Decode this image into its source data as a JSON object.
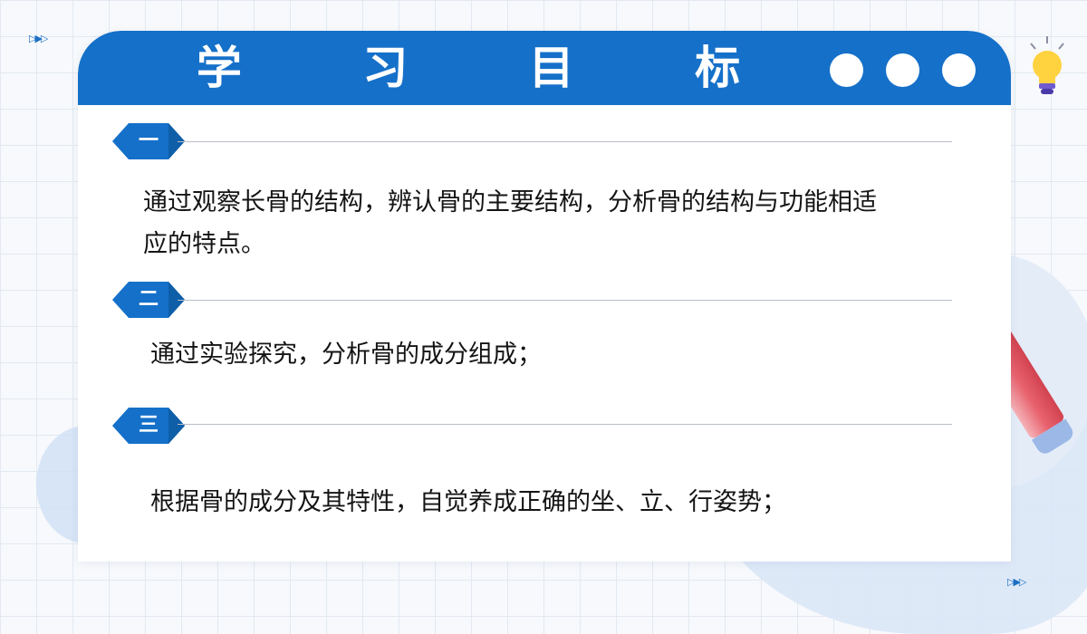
{
  "title": "学 习 目 标",
  "objectives": [
    {
      "marker": "一",
      "text_line1": "通过观察长骨的结构，辨认骨的主要结构，分析骨的结构与功能相适",
      "text_line2": "应的特点。"
    },
    {
      "marker": "二",
      "text_line1": "通过实验探究，分析骨的成分组成；"
    },
    {
      "marker": "三",
      "text_line1": "根据骨的成分及其特性，自觉养成正确的坐、立、行姿势；"
    }
  ],
  "colors": {
    "accent": "#1570c9",
    "badge_dark": "#0e5ea8"
  },
  "icons": [
    "lightbulb-icon",
    "triangle-arrows-icon",
    "pencil-icon"
  ]
}
